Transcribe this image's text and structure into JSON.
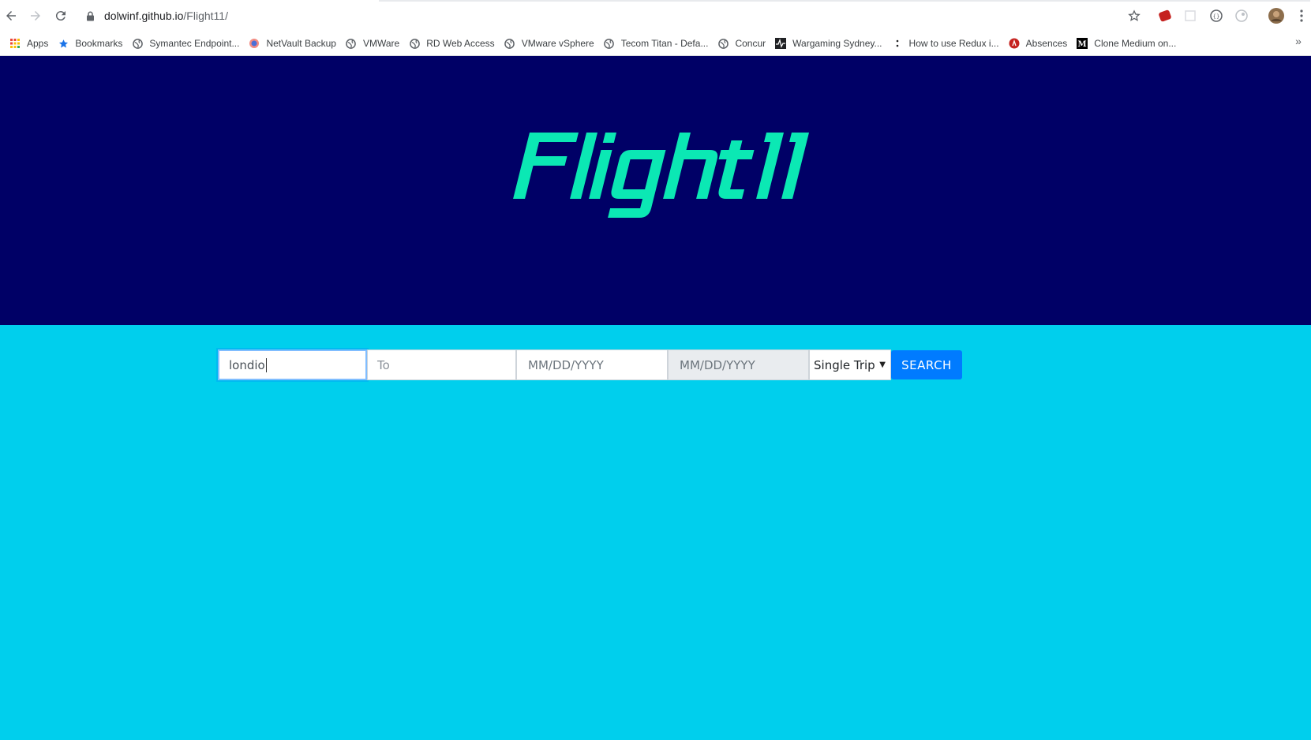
{
  "browser": {
    "url_host": "dolwinf.github.io",
    "url_path": "/Flight11/",
    "bookmarks": [
      {
        "label": "Apps",
        "icon": "apps-grid-icon"
      },
      {
        "label": "Bookmarks",
        "icon": "star-icon"
      },
      {
        "label": "Symantec Endpoint...",
        "icon": "globe-icon"
      },
      {
        "label": "NetVault Backup",
        "icon": "netvault-icon"
      },
      {
        "label": "VMWare",
        "icon": "globe-icon"
      },
      {
        "label": "RD Web Access",
        "icon": "globe-icon"
      },
      {
        "label": "VMware vSphere",
        "icon": "globe-icon"
      },
      {
        "label": "Tecom Titan - Defa...",
        "icon": "globe-icon"
      },
      {
        "label": "Concur",
        "icon": "globe-icon"
      },
      {
        "label": "Wargaming Sydney...",
        "icon": "pulse-icon"
      },
      {
        "label": "How to use Redux i...",
        "icon": "dots-icon"
      },
      {
        "label": "Absences",
        "icon": "absences-icon"
      },
      {
        "label": "Clone Medium on...",
        "icon": "medium-icon"
      }
    ],
    "more_label": "»"
  },
  "brand": {
    "logo_text": "Flight11",
    "logo_color": "#0be8b4"
  },
  "colors": {
    "hero_bg": "#000066",
    "search_bg": "#00cfed",
    "button_bg": "#007bff"
  },
  "search": {
    "from_value": "londio",
    "to_placeholder": "To",
    "depart_placeholder": "MM/DD/YYYY",
    "return_placeholder": "MM/DD/YYYY",
    "trip_type": "Single Trip",
    "button_label": "SEARCH"
  }
}
